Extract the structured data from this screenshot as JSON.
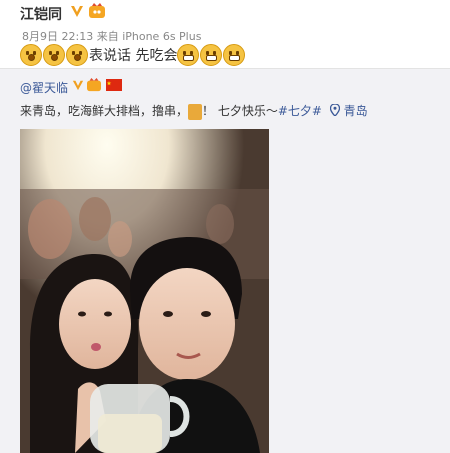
{
  "post": {
    "author": "江铠同",
    "meta_date": "8月9日",
    "meta_time": "22:13",
    "meta_from": "来自 iPhone 6s Plus",
    "text": "表说话 先吃会",
    "emoji_before": [
      "hush-emoji",
      "hush-emoji",
      "hush-emoji"
    ],
    "emoji_after": [
      "grin-emoji",
      "grin-emoji",
      "grin-emoji"
    ]
  },
  "repost": {
    "author": "@翟天临",
    "text_main": "来青岛，吃海鲜大排档，撸串，",
    "text_exclaim": "！ 七夕快乐～",
    "hashtag": "#七夕#",
    "location": "青岛",
    "photo_icon": "selfie-photo"
  },
  "colors": {
    "link": "#3b5998",
    "verified": "#f0a020",
    "emoji": "#f5c342"
  }
}
